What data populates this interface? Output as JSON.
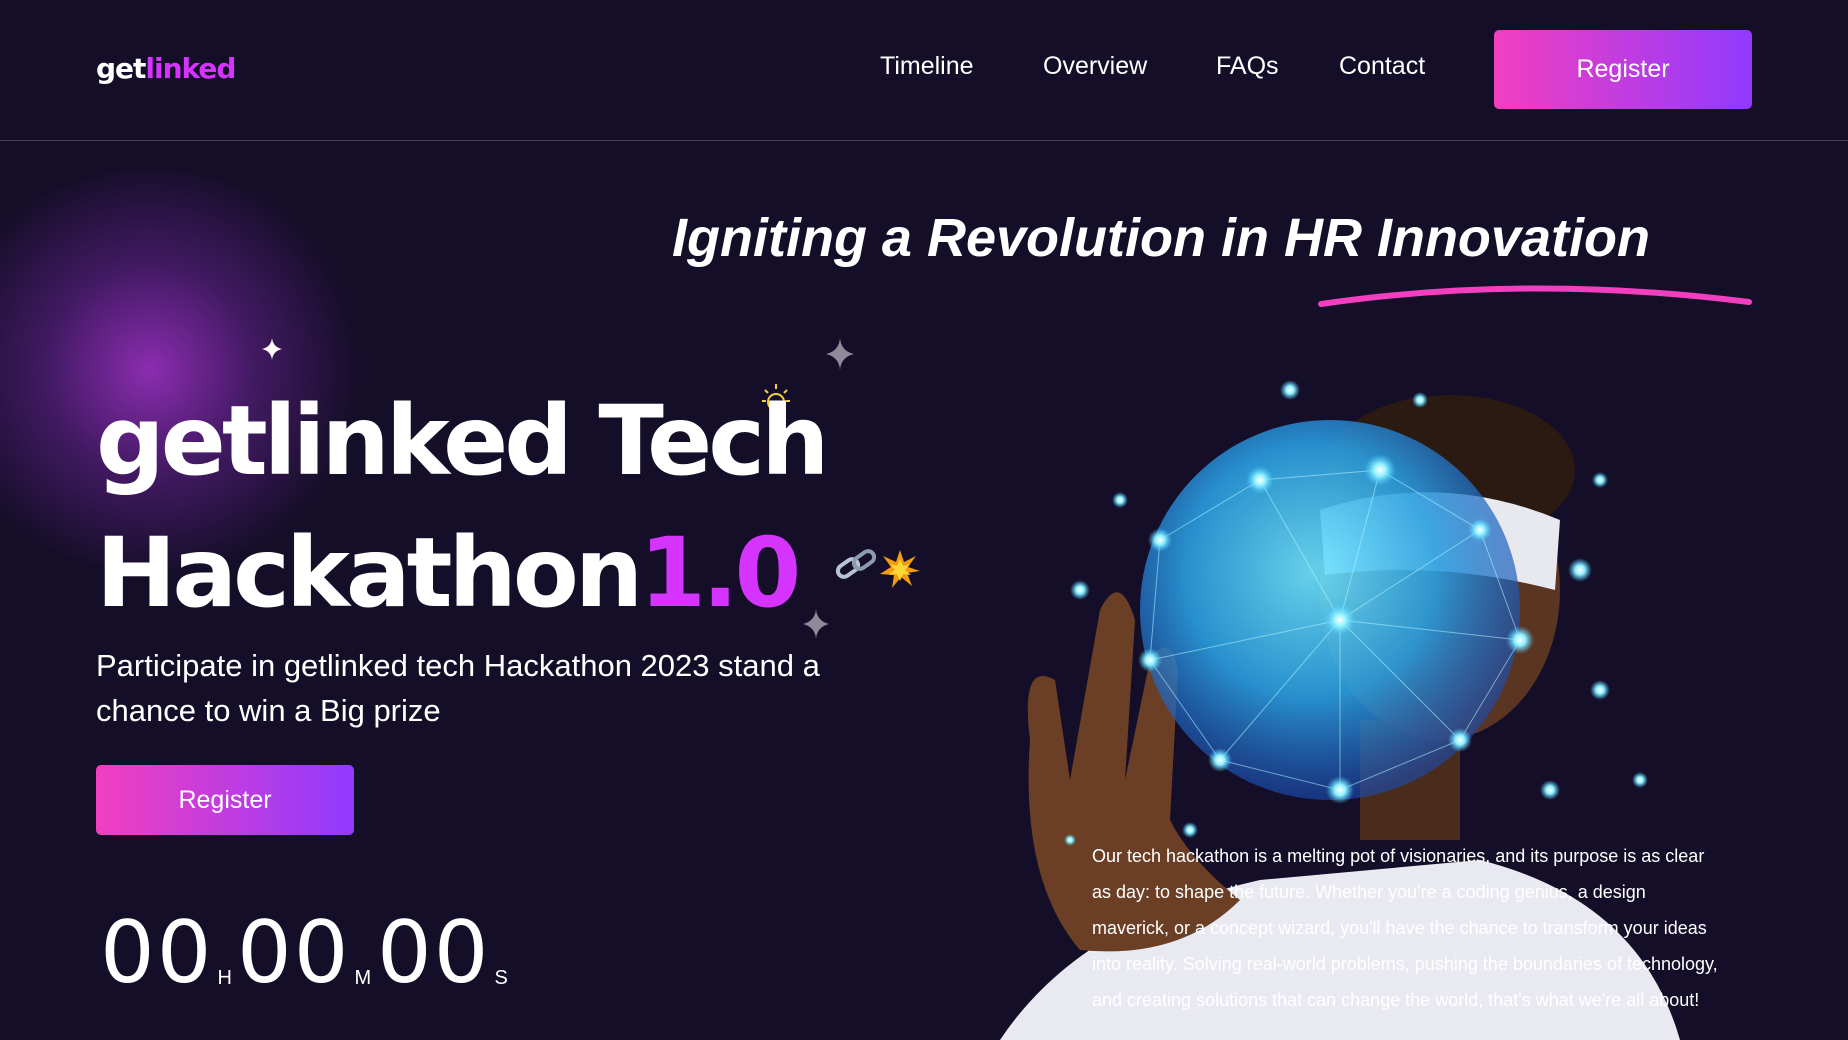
{
  "header": {
    "logo": {
      "part1": "get",
      "part2": "linked"
    },
    "nav": [
      "Timeline",
      "Overview",
      "FAQs",
      "Contact"
    ],
    "register_label": "Register"
  },
  "hero": {
    "tagline": "Igniting a Revolution in HR Innovation",
    "title_line1": "getlinked Tech",
    "title_line2": "Hackathon",
    "version": "1.0",
    "subtitle": "Participate in getlinked tech Hackathon 2023 stand a chance to win a Big prize",
    "register_label": "Register",
    "timer": {
      "hours": "00",
      "hours_unit": "H",
      "minutes": "00",
      "minutes_unit": "M",
      "seconds": "00",
      "seconds_unit": "S"
    },
    "description": "Our tech hackathon is a melting pot of visionaries, and its purpose is as clear as day: to shape the future. Whether you're a coding genius, a design maverick, or a concept wizard, you'll have the chance to transform your ideas into reality. Solving real-world problems, pushing the boundaries of technology, and creating solutions that can change the world, that's what we're all about!",
    "image_alt": "man wearing VR headset with glowing globe network"
  },
  "colors": {
    "background": "#150e28",
    "accent": "#d434fe",
    "gradient_start": "#f23fbf",
    "gradient_end": "#903aff",
    "underline": "#f23fbf"
  }
}
